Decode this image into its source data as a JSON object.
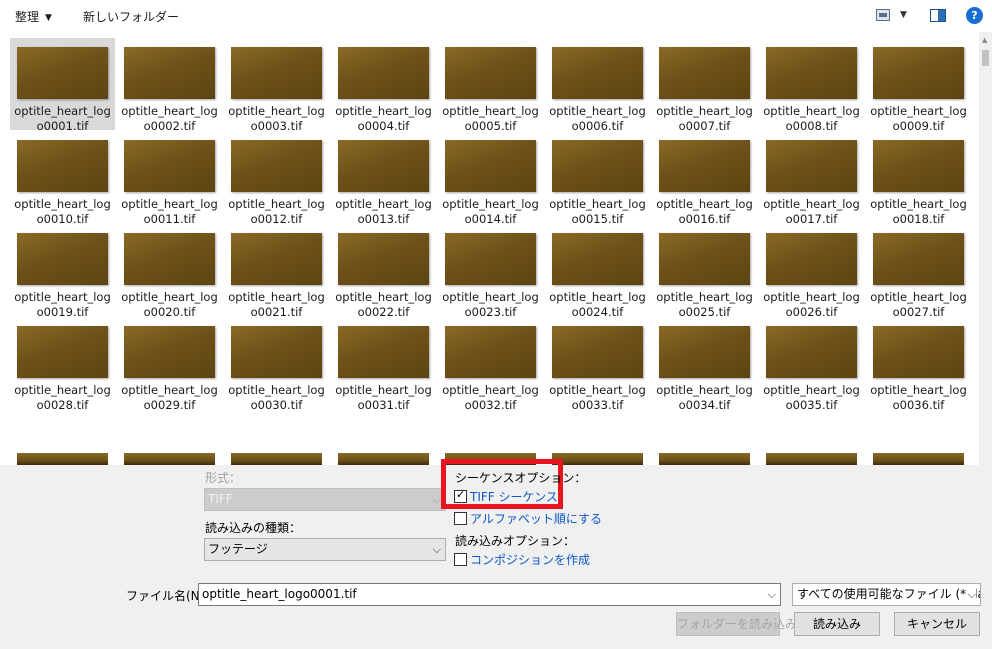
{
  "toolbar": {
    "organize_label": "整理",
    "new_folder_label": "新しいフォルダー",
    "help_label": "?"
  },
  "files": [
    {
      "line1": "optitle_heart_log",
      "line2": "o0001.tif",
      "selected": true
    },
    {
      "line1": "optitle_heart_log",
      "line2": "o0002.tif"
    },
    {
      "line1": "optitle_heart_log",
      "line2": "o0003.tif"
    },
    {
      "line1": "optitle_heart_log",
      "line2": "o0004.tif"
    },
    {
      "line1": "optitle_heart_log",
      "line2": "o0005.tif"
    },
    {
      "line1": "optitle_heart_log",
      "line2": "o0006.tif"
    },
    {
      "line1": "optitle_heart_log",
      "line2": "o0007.tif"
    },
    {
      "line1": "optitle_heart_log",
      "line2": "o0008.tif"
    },
    {
      "line1": "optitle_heart_log",
      "line2": "o0009.tif"
    },
    {
      "line1": "optitle_heart_log",
      "line2": "o0010.tif"
    },
    {
      "line1": "optitle_heart_log",
      "line2": "o0011.tif"
    },
    {
      "line1": "optitle_heart_log",
      "line2": "o0012.tif"
    },
    {
      "line1": "optitle_heart_log",
      "line2": "o0013.tif"
    },
    {
      "line1": "optitle_heart_log",
      "line2": "o0014.tif"
    },
    {
      "line1": "optitle_heart_log",
      "line2": "o0015.tif"
    },
    {
      "line1": "optitle_heart_log",
      "line2": "o0016.tif"
    },
    {
      "line1": "optitle_heart_log",
      "line2": "o0017.tif"
    },
    {
      "line1": "optitle_heart_log",
      "line2": "o0018.tif"
    },
    {
      "line1": "optitle_heart_log",
      "line2": "o0019.tif"
    },
    {
      "line1": "optitle_heart_log",
      "line2": "o0020.tif"
    },
    {
      "line1": "optitle_heart_log",
      "line2": "o0021.tif"
    },
    {
      "line1": "optitle_heart_log",
      "line2": "o0022.tif"
    },
    {
      "line1": "optitle_heart_log",
      "line2": "o0023.tif"
    },
    {
      "line1": "optitle_heart_log",
      "line2": "o0024.tif"
    },
    {
      "line1": "optitle_heart_log",
      "line2": "o0025.tif"
    },
    {
      "line1": "optitle_heart_log",
      "line2": "o0026.tif"
    },
    {
      "line1": "optitle_heart_log",
      "line2": "o0027.tif"
    },
    {
      "line1": "optitle_heart_log",
      "line2": "o0028.tif"
    },
    {
      "line1": "optitle_heart_log",
      "line2": "o0029.tif"
    },
    {
      "line1": "optitle_heart_log",
      "line2": "o0030.tif"
    },
    {
      "line1": "optitle_heart_log",
      "line2": "o0031.tif"
    },
    {
      "line1": "optitle_heart_log",
      "line2": "o0032.tif"
    },
    {
      "line1": "optitle_heart_log",
      "line2": "o0033.tif"
    },
    {
      "line1": "optitle_heart_log",
      "line2": "o0034.tif"
    },
    {
      "line1": "optitle_heart_log",
      "line2": "o0035.tif"
    },
    {
      "line1": "optitle_heart_log",
      "line2": "o0036.tif"
    }
  ],
  "options": {
    "format_label": "形式：",
    "format_value": "TIFF",
    "import_type_label": "読み込みの種類：",
    "import_type_value": "フッテージ",
    "sequence_options_label": "シーケンスオプション：",
    "tiff_sequence_label": "TIFF シーケンス",
    "tiff_sequence_checked": true,
    "alphabetical_label": "アルファベット順にする",
    "alphabetical_checked": false,
    "import_options_label": "読み込みオプション：",
    "composition_label": "コンポジションを作成",
    "composition_checked": false
  },
  "footer": {
    "filename_label": "ファイル名(N):",
    "filename_value": "optitle_heart_logo0001.tif",
    "filetype_value": "すべての使用可能なファイル (*.fla;*",
    "import_folder_label": "フォルダーを読み込み",
    "import_label": "読み込み",
    "cancel_label": "キャンセル"
  },
  "colors": {
    "highlight_box": "#e8141e",
    "link_blue": "#0e58c8",
    "thumbnail_brown": "#6d5118"
  }
}
